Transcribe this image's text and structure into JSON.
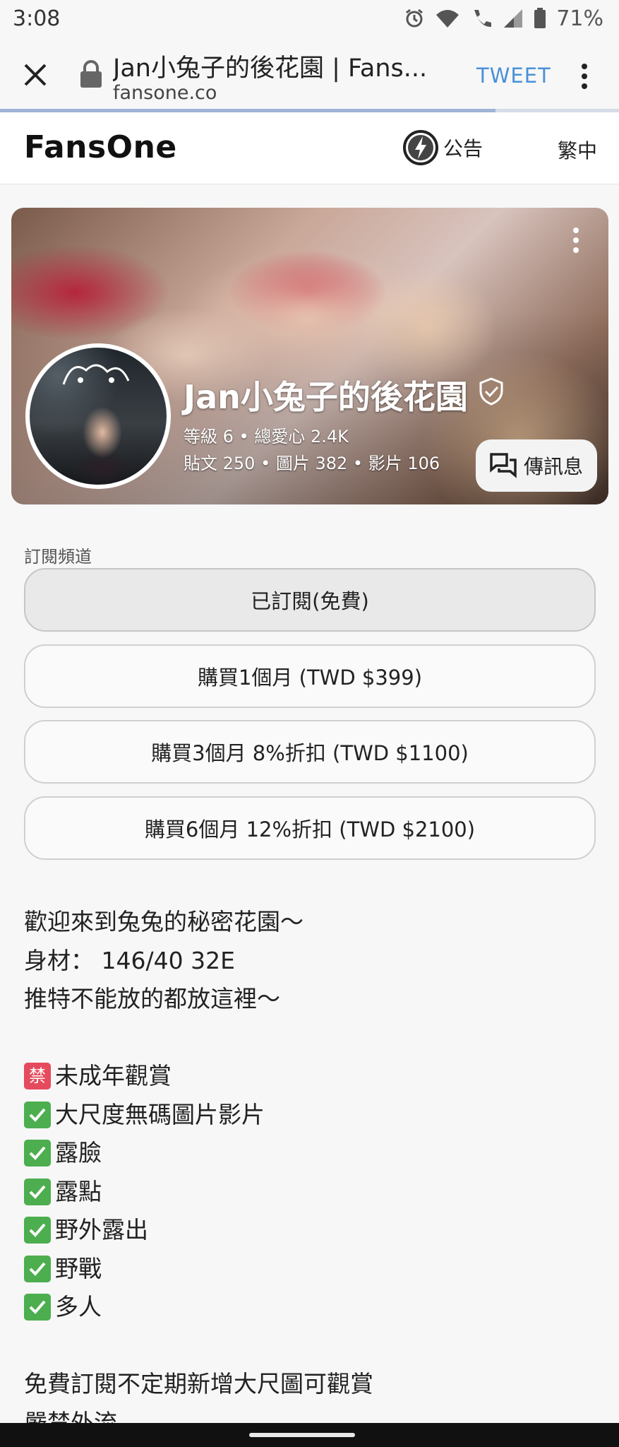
{
  "status_bar": {
    "time": "3:08",
    "battery": "71%",
    "icons": [
      "alarm-icon",
      "wifi-icon",
      "call-icon",
      "signal-icon",
      "battery-icon"
    ]
  },
  "browser": {
    "page_title": "Jan小兔子的後花園 | Fans...",
    "domain": "fansone.co",
    "tweet_label": "TWEET",
    "load_progress": 0.8
  },
  "site_header": {
    "brand": "FansOne",
    "announce_label": "公告",
    "language": "繁中"
  },
  "profile": {
    "name": "Jan小兔子的後花園",
    "stats_line1": "等級 6 • 總愛心 2.4K",
    "stats_line2": "貼文 250 • 圖片 382 • 影片 106",
    "message_label": "傳訊息"
  },
  "subscription": {
    "section_label": "訂閱頻道",
    "options": [
      "已訂閱(免費)",
      "購買1個月 (TWD $399)",
      "購買3個月 8%折扣 (TWD $1100)",
      "購買6個月 12%折扣 (TWD $2100)"
    ]
  },
  "description": {
    "intro": [
      "歡迎來到兔兔的秘密花園～",
      "身材：  146/40 32E",
      "推特不能放的都放這裡～"
    ],
    "ban_emoji": "禁",
    "ban_line": "未成年觀賞",
    "checks": [
      "大尺度無碼圖片影片",
      "露臉",
      "露點",
      "野外露出",
      "野戰",
      "多人"
    ],
    "outro": [
      "免費訂閱不定期新增大尺圖可觀賞",
      "嚴禁外流"
    ]
  },
  "colors": {
    "accent": "#4a90d9",
    "check_green": "#4cae4f",
    "ban_red": "#e54b5c"
  }
}
